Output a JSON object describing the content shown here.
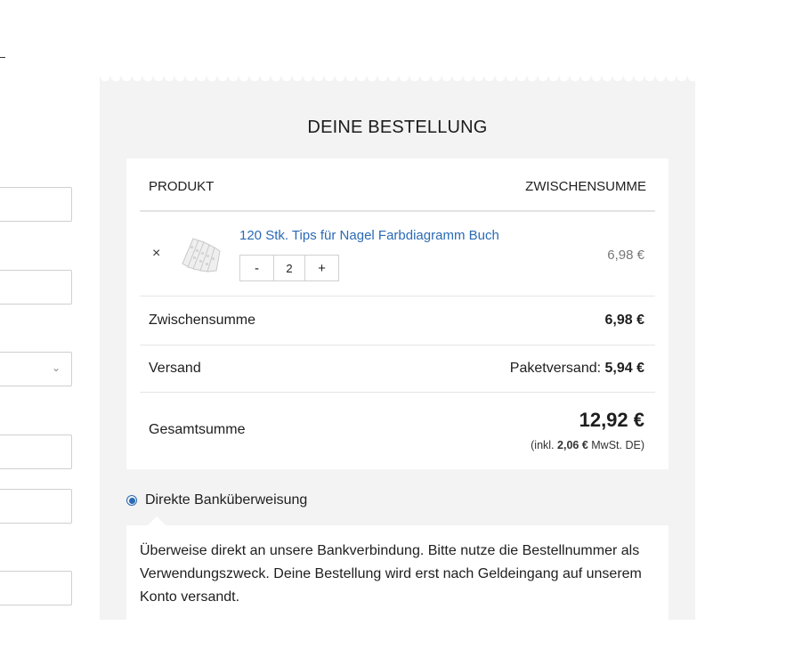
{
  "order": {
    "title": "DEINE BESTELLUNG",
    "columns": {
      "product": "PRODUKT",
      "subtotal": "ZWISCHENSUMME"
    },
    "item": {
      "remove_symbol": "×",
      "name": "120 Stk. Tips für Nagel Farbdiagramm Buch",
      "quantity": "2",
      "minus": "-",
      "plus": "+",
      "price": "6,98 €"
    },
    "subtotal": {
      "label": "Zwischensumme",
      "amount": "6,98 €"
    },
    "shipping": {
      "label": "Versand",
      "method": "Paketversand:",
      "amount": "5,94 €"
    },
    "total": {
      "label": "Gesamtsumme",
      "amount": "12,92 €",
      "tax_prefix": "(inkl.",
      "tax_amount": "2,06 €",
      "tax_suffix": "MwSt. DE)"
    }
  },
  "payment": {
    "method_label": "Direkte Banküberweisung",
    "selected": true,
    "description": "Überweise direkt an unsere Bankverbindung. Bitte nutze die Bestellnummer als Verwendungszweck. Deine Bestellung wird erst nach Geldeingang auf unserem Konto versandt."
  },
  "left_form": {
    "select_chevron": "⌄"
  },
  "colors": {
    "accent": "#2a6ab5",
    "panel": "#f3f3f3"
  }
}
